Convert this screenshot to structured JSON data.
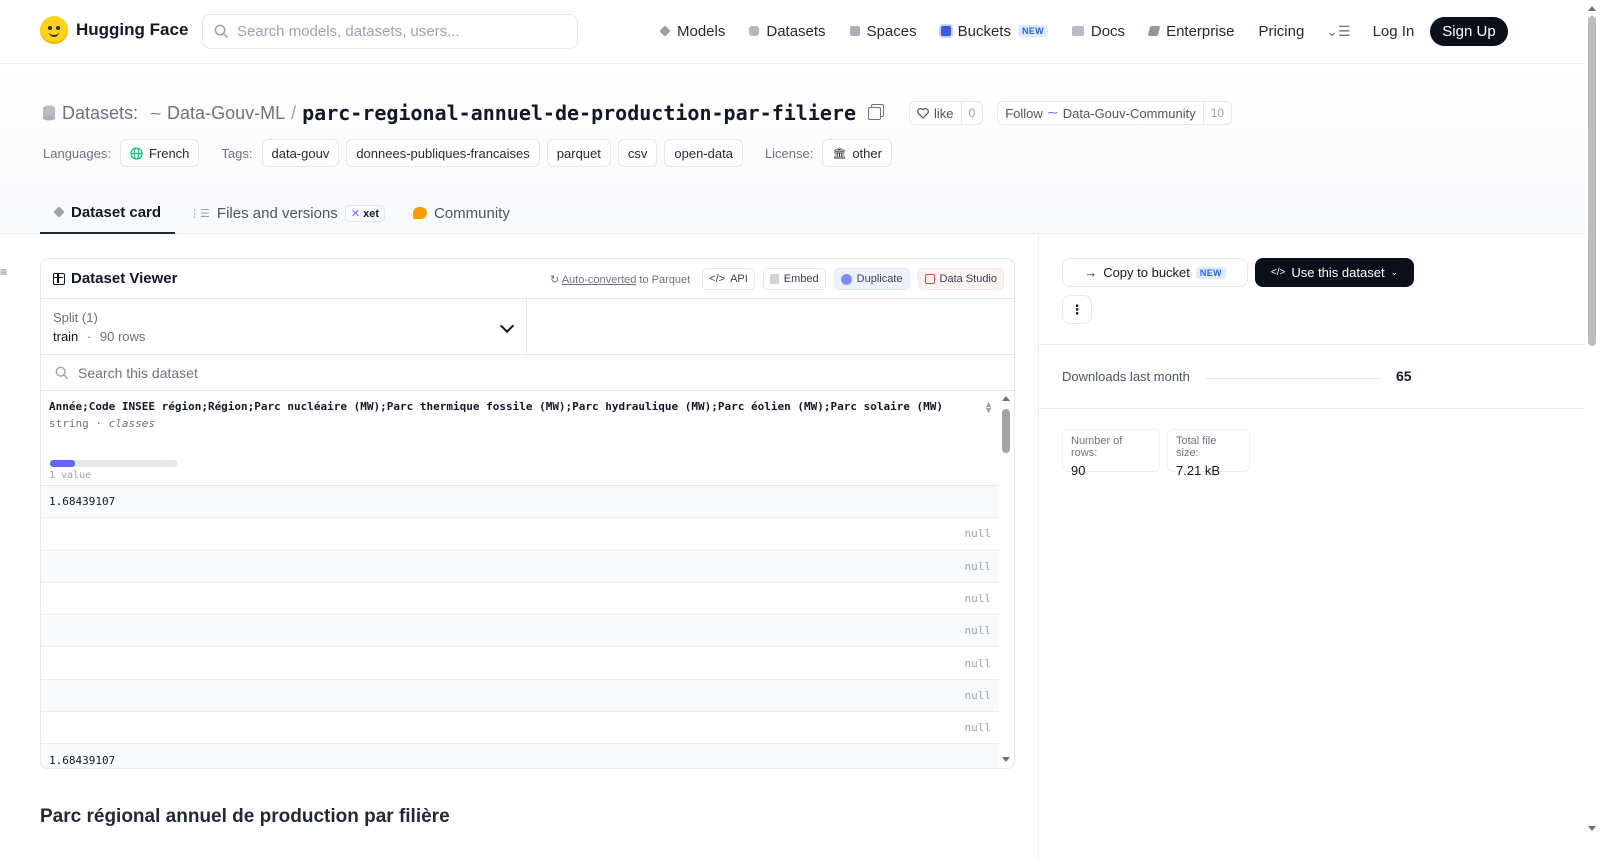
{
  "nav": {
    "brand": "Hugging Face",
    "search_placeholder": "Search models, datasets, users...",
    "links": [
      {
        "label": "Models",
        "icon": "cube-icon"
      },
      {
        "label": "Datasets",
        "icon": "database-icon"
      },
      {
        "label": "Spaces",
        "icon": "grid-icon"
      },
      {
        "label": "Buckets",
        "icon": "bucket-icon",
        "badge": "NEW"
      },
      {
        "label": "Docs",
        "icon": "book-icon"
      },
      {
        "label": "Enterprise",
        "icon": "enterprise-icon"
      },
      {
        "label": "Pricing"
      }
    ],
    "login": "Log In",
    "signup": "Sign Up"
  },
  "header": {
    "crumb_type": "Datasets:",
    "org": "Data-Gouv-ML",
    "separator": "/",
    "name": "parc-regional-annuel-de-production-par-filiere",
    "like_label": "like",
    "like_count": "0",
    "follow_label": "Follow",
    "follow_org": "Data-Gouv-Community",
    "follow_count": "10",
    "languages_label": "Languages:",
    "language": "French",
    "tags_label": "Tags:",
    "tags": [
      "data-gouv",
      "donnees-publiques-francaises",
      "parquet",
      "csv",
      "open-data"
    ],
    "license_label": "License:",
    "license": "other",
    "tabs": [
      {
        "label": "Dataset card",
        "active": true
      },
      {
        "label": "Files and versions",
        "badge": "xet"
      },
      {
        "label": "Community"
      }
    ]
  },
  "viewer": {
    "title": "Dataset Viewer",
    "auto_converted_link": "Auto-converted",
    "auto_converted_rest": "to Parquet",
    "buttons": {
      "api": "API",
      "embed": "Embed",
      "duplicate": "Duplicate",
      "data_studio": "Data Studio"
    },
    "split_label": "Split (1)",
    "split_value": "train",
    "split_dot": "·",
    "split_rows": "90 rows",
    "search_placeholder": "Search this dataset",
    "column": {
      "name": "Année;Code INSEE région;Région;Parc nucléaire (MW);Parc thermique fossile (MW);Parc hydraulique (MW);Parc éolien (MW);Parc solaire (MW)",
      "dtype": "string",
      "dtype_sep": "·",
      "kind": "classes",
      "hist_fraction": 0.2,
      "stat": "1 value"
    },
    "rows": [
      {
        "value": "1.68439107",
        "null": ""
      },
      {
        "value": "",
        "null": "null"
      },
      {
        "value": "",
        "null": "null"
      },
      {
        "value": "",
        "null": "null"
      },
      {
        "value": "",
        "null": "null"
      },
      {
        "value": "",
        "null": "null"
      },
      {
        "value": "",
        "null": "null"
      },
      {
        "value": "",
        "null": "null"
      },
      {
        "value": "1.68439107",
        "null": ""
      }
    ]
  },
  "section_title": "Parc régional annuel de production par filière",
  "sidebar": {
    "copy_bucket": "Copy to bucket",
    "copy_bucket_badge": "NEW",
    "use_dataset": "Use this dataset",
    "downloads_label": "Downloads last month",
    "downloads_value": "65",
    "stats": [
      {
        "label": "Number of rows:",
        "value": "90"
      },
      {
        "label": "Total file size:",
        "value": "7.21 kB"
      }
    ]
  }
}
